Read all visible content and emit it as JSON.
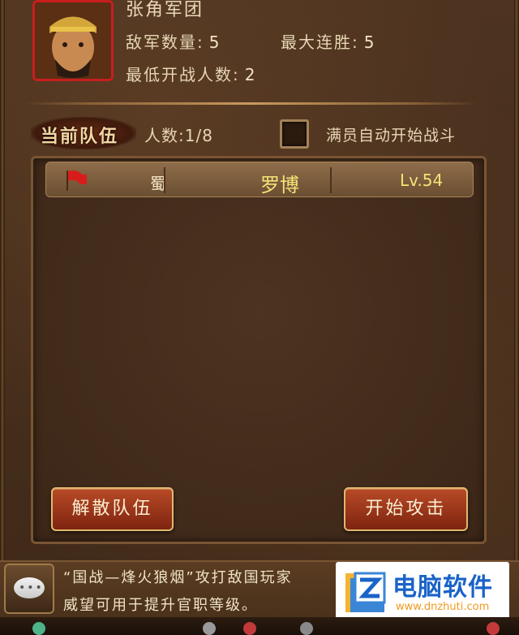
{
  "header": {
    "team_name": "张角军团",
    "enemy_count_label": "敌军数量:",
    "enemy_count_value": "5",
    "max_streak_label": "最大连胜:",
    "max_streak_value": "5",
    "min_players_label": "最低开战人数:",
    "min_players_value": "2"
  },
  "team": {
    "tag": "当前队伍",
    "member_count": "人数:1/8",
    "auto_start_label": "满员自动开始战斗",
    "auto_start_checked": false
  },
  "members": [
    {
      "kingdom": "蜀",
      "name": "罗博",
      "level": "Lv.54"
    }
  ],
  "buttons": {
    "disband": "解散队伍",
    "attack": "开始攻击"
  },
  "chat": {
    "line1": "“国战—烽火狼烟”攻打敌国玩家",
    "line2": "威望可用于提升官职等级。"
  },
  "watermark": {
    "title": "电脑软件",
    "url": "www.dnzhuti.com"
  },
  "colors": {
    "accent_gold": "#f5e277",
    "button_red": "#9a3318",
    "portrait_border": "#c81e1e"
  }
}
